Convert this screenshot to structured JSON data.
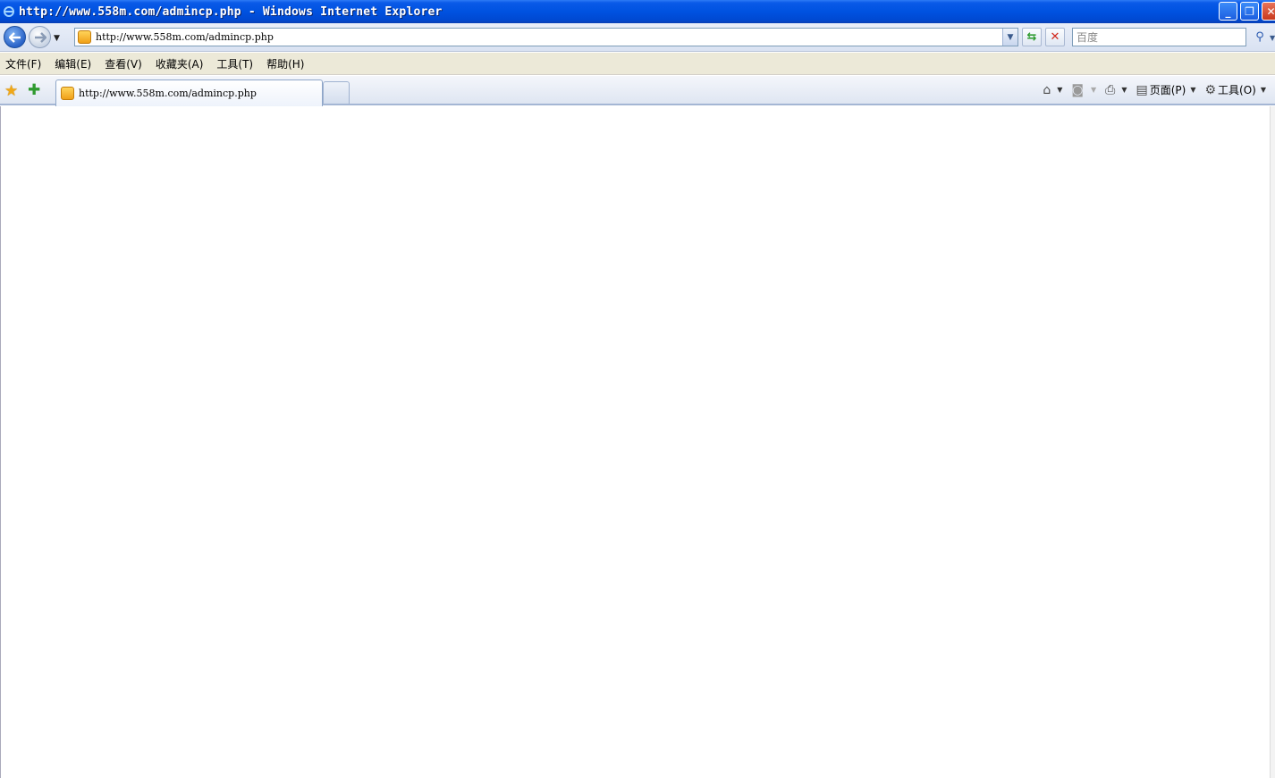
{
  "window": {
    "title": "http://www.558m.com/admincp.php - Windows Internet Explorer",
    "controls": [
      "minimize",
      "restore",
      "close"
    ]
  },
  "addressbar": {
    "url": "http://www.558m.com/admincp.php",
    "search_placeholder": "百度"
  },
  "menu": {
    "items": [
      "文件(F)",
      "编辑(E)",
      "查看(V)",
      "收藏夹(A)",
      "工具(T)",
      "帮助(H)"
    ]
  },
  "tabs": {
    "active_label": "http://www.558m.com/admincp.php"
  },
  "commandbar": {
    "page_label": "页面(P)",
    "tools_label": "工具(O)"
  },
  "colors": {
    "titlebar": "#0052e0",
    "menubar": "#ece9d8",
    "favorite_star": "#f0a818"
  }
}
